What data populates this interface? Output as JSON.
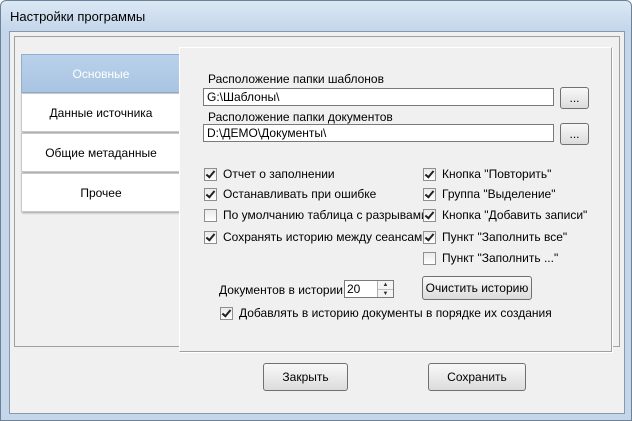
{
  "window": {
    "title": "Настройки программы"
  },
  "tabs": [
    {
      "label": "Основные",
      "active": true
    },
    {
      "label": "Данные источника",
      "active": false
    },
    {
      "label": "Общие метаданные",
      "active": false
    },
    {
      "label": "Прочее",
      "active": false
    }
  ],
  "templates": {
    "label": "Расположение папки шаблонов",
    "value": "G:\\Шаблоны\\",
    "browse": "..."
  },
  "documents": {
    "label": "Расположение папки документов",
    "value": "D:\\ДЕМО\\Документы\\",
    "browse": "..."
  },
  "options_left": [
    {
      "label": "Отчет о заполнении",
      "checked": true
    },
    {
      "label": "Останавливать при ошибке",
      "checked": true
    },
    {
      "label": "По умолчанию таблица с разрывами",
      "checked": false
    },
    {
      "label": "Сохранять историю между сеансами",
      "checked": true
    }
  ],
  "options_right": [
    {
      "label": "Кнопка \"Повторить\"",
      "checked": true
    },
    {
      "label": "Группа \"Выделение\"",
      "checked": true
    },
    {
      "label": "Кнопка \"Добавить записи\"",
      "checked": true
    },
    {
      "label": "Пункт \"Заполнить все\"",
      "checked": true
    },
    {
      "label": "Пункт \"Заполнить ...\"",
      "checked": false
    }
  ],
  "history": {
    "count_label": "Документов в истории",
    "count_value": "20",
    "clear_button": "Очистить историю",
    "order_label": "Добавлять в историю документы в порядке их создания",
    "order_checked": true
  },
  "footer": {
    "close": "Закрыть",
    "save": "Сохранить"
  }
}
